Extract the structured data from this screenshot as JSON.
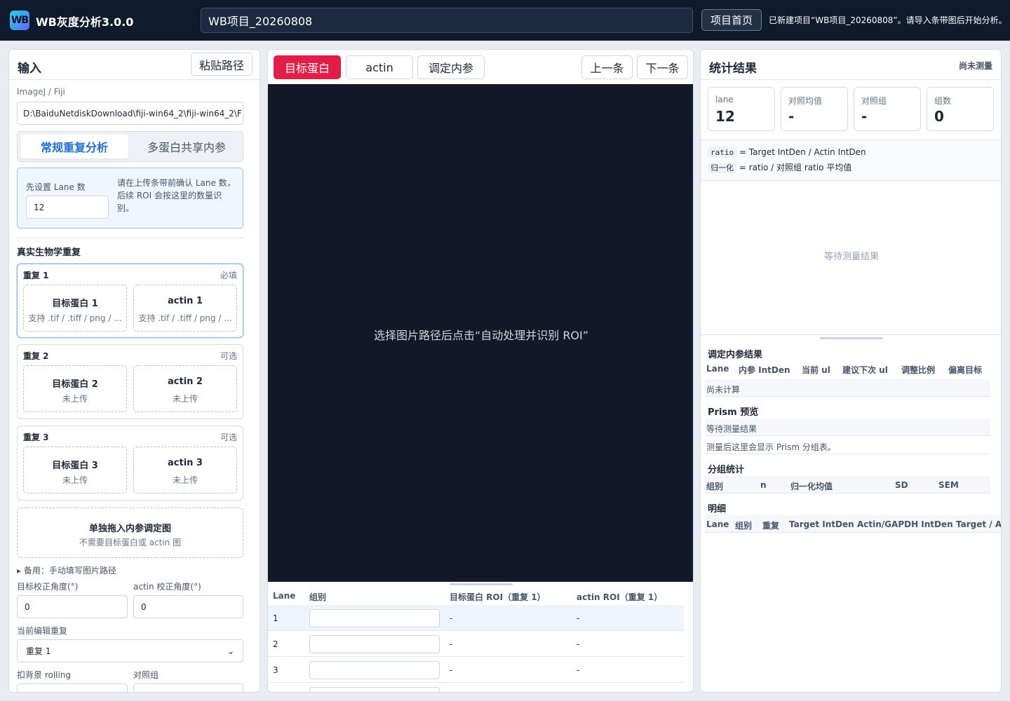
{
  "header": {
    "logo_text": "WB",
    "app_title": "WB灰度分析3.0.0",
    "project_name": "WB项目_20260808",
    "home_label": "项目首页",
    "status": "已新建项目“WB项目_20260808”。请导入条带图后开始分析。"
  },
  "left": {
    "title": "输入",
    "paste_label": "粘贴路径",
    "fiji_label": "ImageJ / Fiji",
    "fiji_path": "D:\\BaiduNetdiskDownload\\fiji-win64_2\\fiji-win64_2\\F",
    "modes": [
      "常规重复分析",
      "多蛋白共享内参"
    ],
    "lane_label": "先设置 Lane 数",
    "lane_value": "12",
    "lane_hint": "请在上传条带前确认 Lane 数，后续 ROI 会按这里的数量识别。",
    "section_title": "真实生物学重复",
    "replicates": [
      {
        "name": "重复 1",
        "tag": "必填",
        "target": "目标蛋白 1",
        "target_sub": "支持 .tif / .tiff / png / ...",
        "actin": "actin 1",
        "actin_sub": "支持 .tif / .tiff / png / ..."
      },
      {
        "name": "重复 2",
        "tag": "可选",
        "target": "目标蛋白 2",
        "target_sub": "未上传",
        "actin": "actin 2",
        "actin_sub": "未上传"
      },
      {
        "name": "重复 3",
        "tag": "可选",
        "target": "目标蛋白 3",
        "target_sub": "未上传",
        "actin": "actin 3",
        "actin_sub": "未上传"
      }
    ],
    "ref_title": "单独拖入内参调定图",
    "ref_sub": "不需要目标蛋白或 actin 图",
    "manual_label": "▸ 备用：手动填写图片路径",
    "target_angle_label": "目标校正角度(°)",
    "target_angle": "0",
    "actin_angle_label": "actin 校正角度(°)",
    "actin_angle": "0",
    "edit_rep_label": "当前编辑重复",
    "edit_rep_value": "重复 1",
    "rolling_label": "扣背景 rolling",
    "control_label": "对照组"
  },
  "center": {
    "tabs": [
      "目标蛋白",
      "actin",
      "调定内参"
    ],
    "prev_label": "上一条",
    "next_label": "下一条",
    "canvas_message": "选择图片路径后点击“自动处理并识别 ROI”",
    "roi_headers": [
      "Lane",
      "组别",
      "目标蛋白 ROI（重复 1）",
      "actin ROI（重复 1）"
    ],
    "roi_rows": [
      {
        "lane": "1",
        "target": "-",
        "actin": "-"
      },
      {
        "lane": "2",
        "target": "-",
        "actin": "-"
      },
      {
        "lane": "3",
        "target": "-",
        "actin": "-"
      }
    ]
  },
  "right": {
    "title": "统计结果",
    "status": "尚未测量",
    "cards": [
      {
        "key": "lane",
        "value": "12"
      },
      {
        "key": "对照均值",
        "value": "-"
      },
      {
        "key": "对照组",
        "value": "-"
      },
      {
        "key": "组数",
        "value": "0"
      }
    ],
    "formula1_code": "ratio",
    "formula1_text": "= Target IntDen / Actin IntDen",
    "formula2_code": "归一化",
    "formula2_text": "= ratio / 对照组 ratio 平均值",
    "wait_message": "等待测量结果",
    "ref_result_title": "调定内参结果",
    "ref_headers": [
      "Lane",
      "内参 IntDen",
      "当前 ul",
      "建议下次 ul",
      "调整比例",
      "偏离目标"
    ],
    "ref_empty": "尚未计算",
    "prism_title": "Prism 预览",
    "prism_wait": "等待测量结果",
    "prism_hint": "测量后这里会显示 Prism 分组表。",
    "group_title": "分组统计",
    "group_headers": [
      "组别",
      "n",
      "归一化均值",
      "SD",
      "SEM"
    ],
    "detail_title": "明细",
    "detail_headers": [
      "Lane",
      "组别",
      "重复",
      "Target IntDen",
      "Actin/GAPDH IntDen",
      "Target / Ac"
    ]
  }
}
